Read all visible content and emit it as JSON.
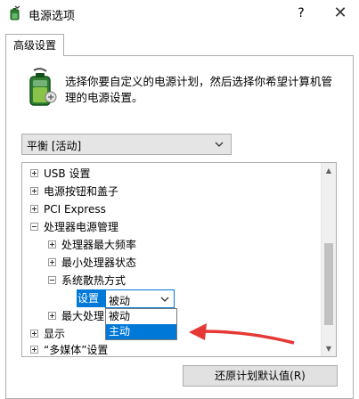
{
  "window": {
    "title": "电源选项",
    "help_label": "?",
    "close_label": "✕"
  },
  "tabs": [
    {
      "label": "高级设置"
    }
  ],
  "description": "选择你要自定义的电源计划，然后选择你希望计算机管理的电源设置。",
  "plan": {
    "value": "平衡 [活动]"
  },
  "tree": {
    "items": [
      {
        "label": "USB 设置",
        "expander": "plus"
      },
      {
        "label": "电源按钮和盖子",
        "expander": "plus"
      },
      {
        "label": "PCI Express",
        "expander": "plus"
      },
      {
        "label": "处理器电源管理",
        "expander": "minus"
      },
      {
        "label": "处理器最大频率",
        "expander": "plus"
      },
      {
        "label": "最小处理器状态",
        "expander": "plus"
      },
      {
        "label": "系统散热方式",
        "expander": "minus"
      },
      {
        "label": "最大处理",
        "expander": "plus"
      },
      {
        "label": "显示",
        "expander": "plus"
      },
      {
        "label": "“多媒体”设置",
        "expander": "plus"
      }
    ],
    "setting_label": "设置",
    "setting_value": "被动",
    "options": [
      "被动",
      "主动"
    ],
    "selected_option": "主动"
  },
  "buttons": {
    "restore": "还原计划默认值(R)"
  },
  "colors": {
    "selection": "#0078d7",
    "annotation_arrow": "#e53935"
  },
  "icons": [
    "power-options-icon",
    "battery-plan-icon",
    "chevron-down-icon",
    "scroll-up-icon",
    "scroll-down-icon"
  ]
}
